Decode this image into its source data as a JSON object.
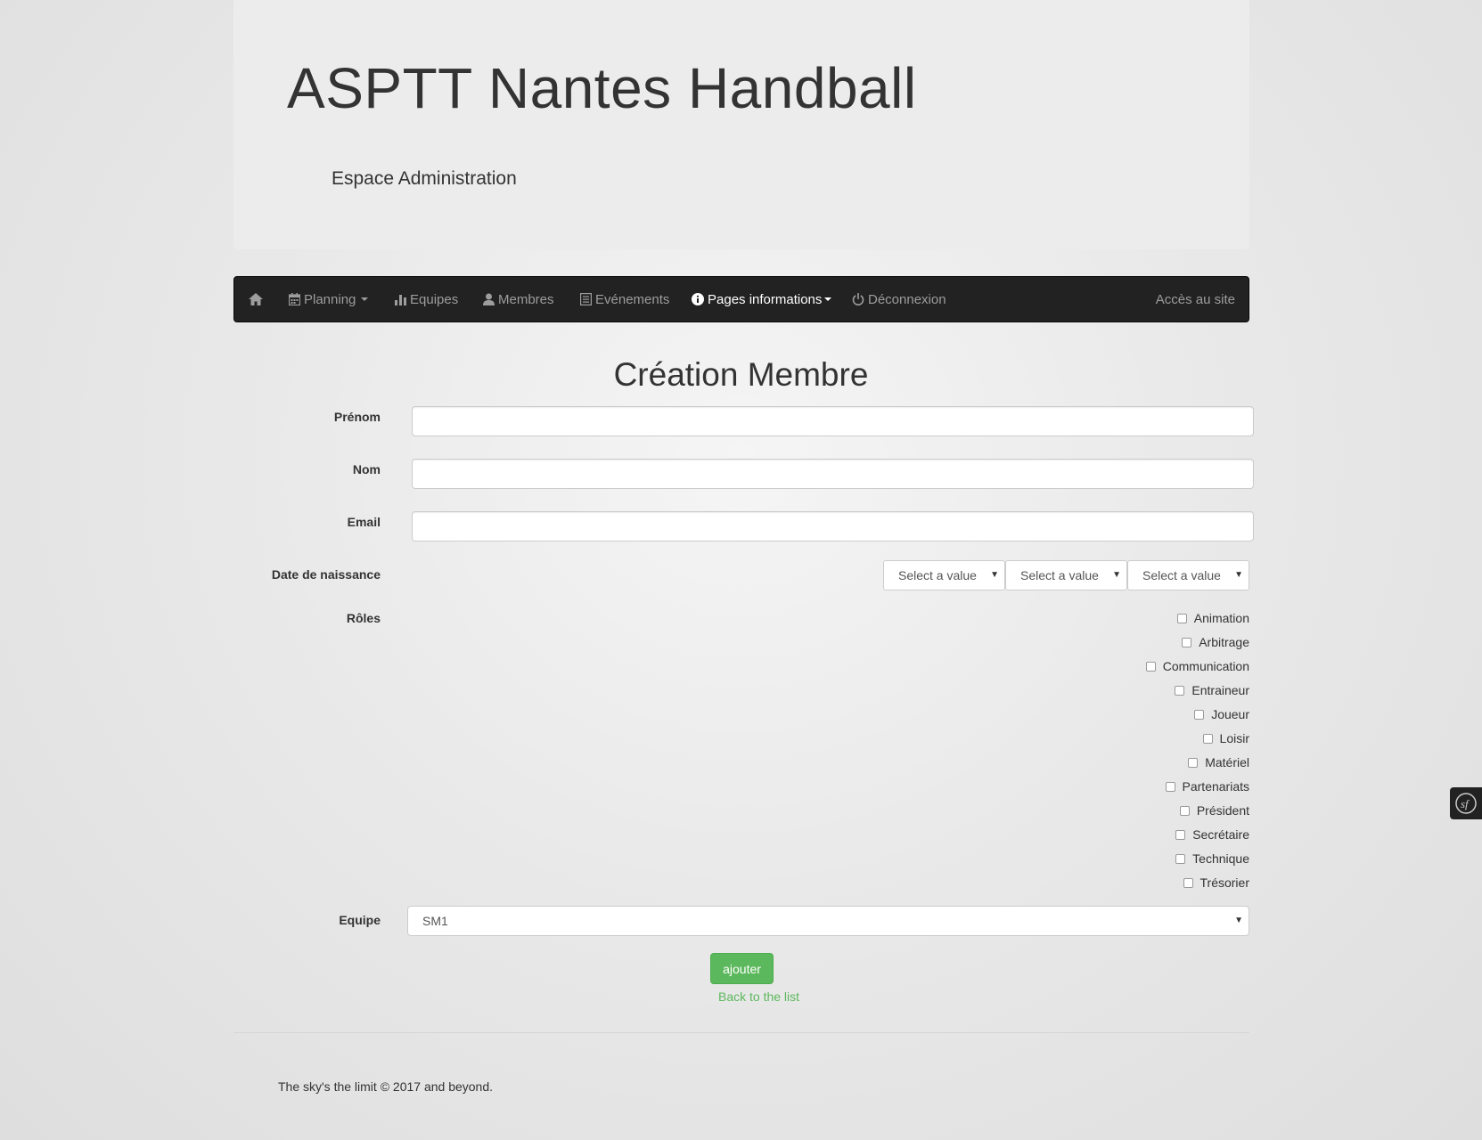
{
  "header": {
    "title": "ASPTT Nantes Handball",
    "subtitle": "Espace Administration"
  },
  "nav": {
    "home_icon": "home-icon",
    "items": [
      {
        "label": "Planning",
        "icon": "calendar-icon",
        "dropdown": true
      },
      {
        "label": "Equipes",
        "icon": "stats-icon",
        "dropdown": false
      },
      {
        "label": "Membres",
        "icon": "user-icon",
        "dropdown": false
      },
      {
        "label": "Evénements",
        "icon": "list-icon",
        "dropdown": false
      },
      {
        "label": "Pages informations",
        "icon": "info-icon",
        "dropdown": true,
        "active": true
      },
      {
        "label": "Déconnexion",
        "icon": "power-icon",
        "dropdown": false
      }
    ],
    "right_link": "Accès au site"
  },
  "form": {
    "title": "Création Membre",
    "fields": {
      "prenom_label": "Prénom",
      "nom_label": "Nom",
      "email_label": "Email",
      "birthdate_label": "Date de naissance",
      "roles_label": "Rôles",
      "equipe_label": "Equipe"
    },
    "birthdate_selects": [
      "Select a value",
      "Select a value",
      "Select a value"
    ],
    "roles": [
      "Animation",
      "Arbitrage",
      "Communication",
      "Entraineur",
      "Joueur",
      "Loisir",
      "Matériel",
      "Partenariats",
      "Président",
      "Secrétaire",
      "Technique",
      "Trésorier"
    ],
    "equipe_value": "SM1",
    "submit_label": "ajouter",
    "back_label": "Back to the list"
  },
  "footer": {
    "text": "The sky's the limit © 2017 and beyond."
  },
  "colors": {
    "navbar_bg": "#222222",
    "success": "#5cb85c",
    "jumbotron_bg": "#ececec"
  }
}
